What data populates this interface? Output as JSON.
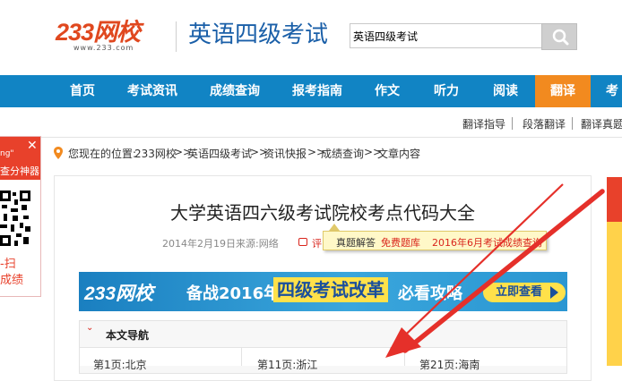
{
  "header": {
    "logo_brand": "233网校",
    "logo_domain": "www.233.com",
    "site_title": "英语四级考试",
    "search": {
      "value": "英语四级考试",
      "placeholder": ""
    }
  },
  "nav": {
    "items": [
      {
        "label": "首页"
      },
      {
        "label": "考试资讯"
      },
      {
        "label": "成绩查询"
      },
      {
        "label": "报考指南"
      },
      {
        "label": "作文"
      },
      {
        "label": "听力"
      },
      {
        "label": "阅读"
      },
      {
        "label": "翻译"
      },
      {
        "label": "考"
      }
    ],
    "active_label": "翻译",
    "bar_color": "#1184c4",
    "active_color": "#f28a1f"
  },
  "subnav": {
    "items": [
      {
        "label": "翻译指导"
      },
      {
        "label": "段落翻译"
      },
      {
        "label": "翻译真题"
      }
    ]
  },
  "left_ad": {
    "line1": "ng\"",
    "line2": "查分神器",
    "line3": "-扫",
    "line4": "成绩"
  },
  "breadcrumb": {
    "prefix": "您现在的位置:",
    "items": [
      "233网校",
      "英语四级考试",
      "资讯快报",
      "成绩查询",
      "文章内容"
    ],
    "separator": ">>"
  },
  "article": {
    "title": "大学英语四六级考试院校考点代码大全",
    "date": "2014年2月19日",
    "source": "来源:网络",
    "comment_label": "评"
  },
  "tooltip": {
    "links": [
      "真题解答",
      "免费题库",
      "2016年6月考试成绩查询"
    ]
  },
  "banner": {
    "logo": "233网校",
    "text1": "备战2016年",
    "text2": "四级考试改革",
    "text3": "必看攻略",
    "button": "立即查看"
  },
  "toc": {
    "title": "本文导航",
    "items": [
      "第1页:北京",
      "第11页:浙江",
      "第21页:海南"
    ]
  }
}
